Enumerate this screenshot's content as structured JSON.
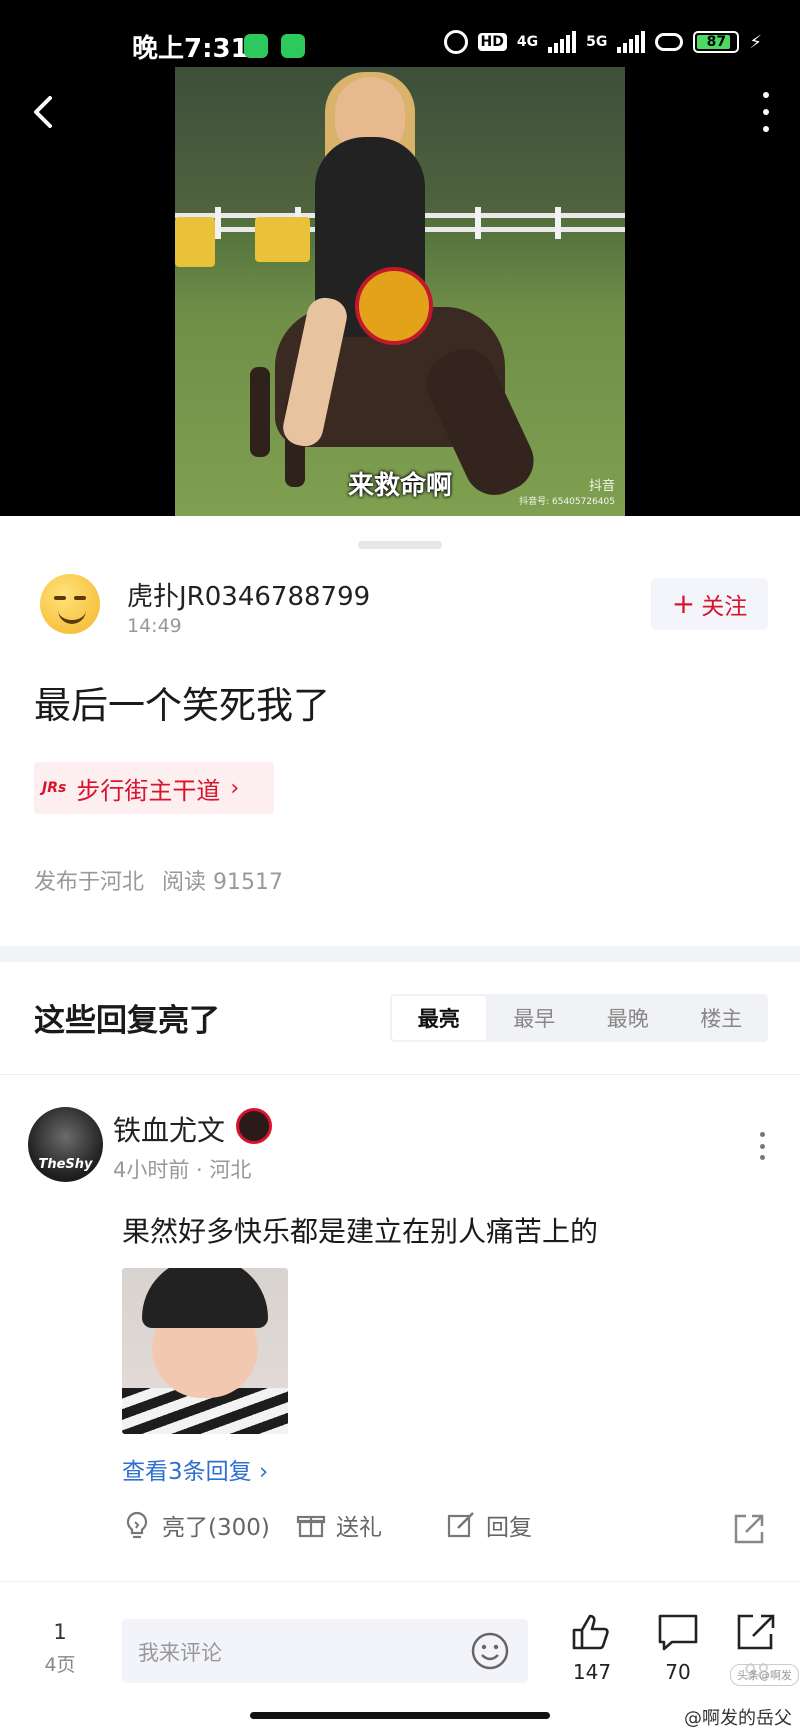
{
  "status_bar": {
    "time": "晚上7:31",
    "hd": "HD",
    "net1": "4G",
    "net2": "5G",
    "battery": "87",
    "battery_level": 0.87
  },
  "video": {
    "caption": "来救命啊",
    "watermark": "抖音",
    "watermark_id": "抖音号: 65405726405"
  },
  "post": {
    "author": "虎扑JR0346788799",
    "time": "14:49",
    "follow_label": "关注",
    "title": "最后一个笑死我了",
    "board_icon_text": "JRs",
    "board": "步行街主干道",
    "location": "发布于河北",
    "reads": "阅读 91517"
  },
  "replies": {
    "title": "这些回复亮了",
    "tabs": [
      "最亮",
      "最早",
      "最晚",
      "楼主"
    ],
    "active_tab": "最亮"
  },
  "comment": {
    "avatar_text": "TheShy",
    "username": "铁血尤文",
    "meta": "4小时前 · 河北",
    "text": "果然好多快乐都是建立在别人痛苦上的",
    "view_replies": "查看3条回复 ›",
    "light_label": "亮了(300)",
    "gift_label": "送礼",
    "reply_label": "回复"
  },
  "bottom_bar": {
    "page_current": "1",
    "page_total": "4页",
    "input_placeholder": "我来评论",
    "likes": "147",
    "comments": "70",
    "shares": "98"
  },
  "watermarks": {
    "corner": "@啊发的岳父",
    "stamp": "头条@啊发"
  },
  "colors": {
    "brand_red": "#d7142c",
    "link_blue": "#2f6fd1",
    "battery_green": "#4cd964"
  }
}
